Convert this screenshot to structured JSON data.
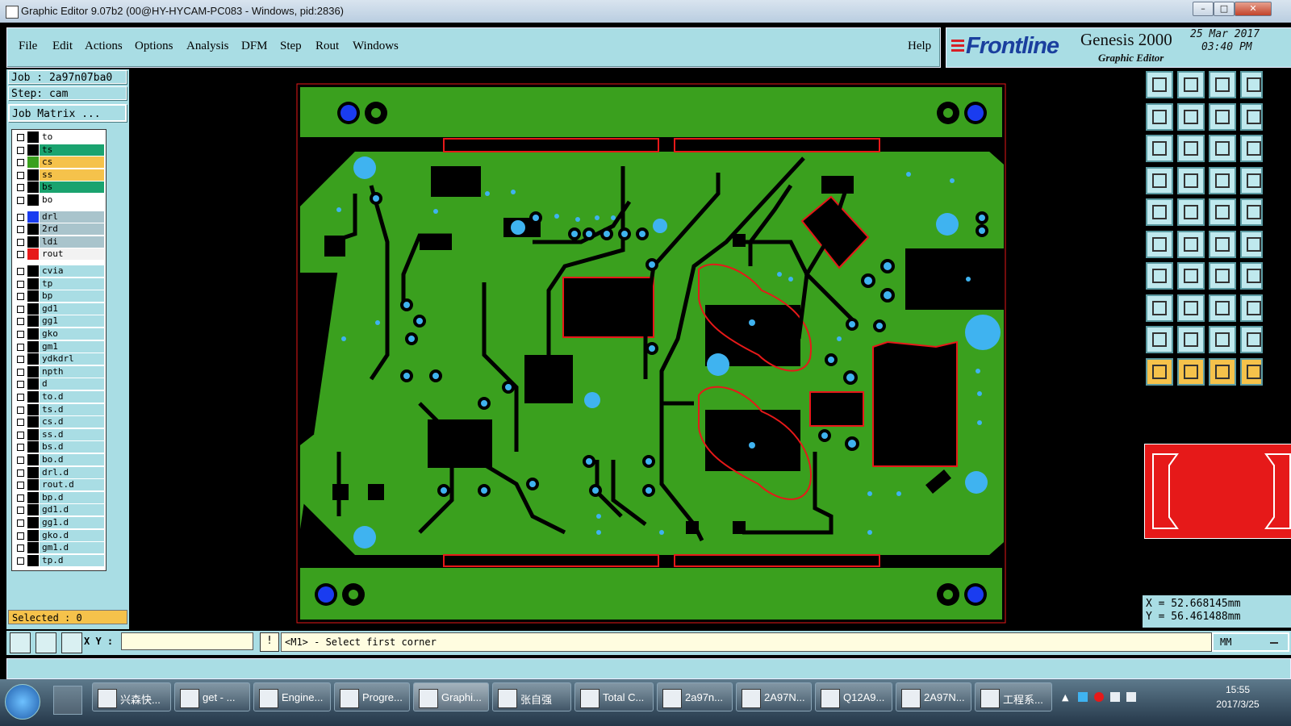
{
  "window": {
    "title": "Graphic Editor 9.07b2 (00@HY-HYCAM-PC083 - Windows, pid:2836)"
  },
  "menu": {
    "items": [
      "File",
      "Edit",
      "Actions",
      "Options",
      "Analysis",
      "DFM",
      "Step",
      "Rout",
      "Windows"
    ],
    "help": "Help"
  },
  "branding": {
    "logo": "Frontline",
    "product": "Genesis 2000",
    "subtitle": "Graphic Editor",
    "date": "25 Mar 2017",
    "time": "03:40 PM"
  },
  "job": {
    "job_label": "Job : 2a97n07ba0",
    "step_label": "Step: cam",
    "matrix_button": "Job Matrix ..."
  },
  "layers": [
    {
      "name": "to",
      "color": "#ffffff",
      "swatch": "#000000"
    },
    {
      "name": "ts",
      "color": "#1aa36f",
      "swatch": "#000000"
    },
    {
      "name": "cs",
      "color": "#f5c24b",
      "swatch": "#3aa01e"
    },
    {
      "name": "ss",
      "color": "#f5c24b",
      "swatch": "#000000"
    },
    {
      "name": "bs",
      "color": "#1aa36f",
      "swatch": "#000000"
    },
    {
      "name": "bo",
      "color": "#ffffff",
      "swatch": "#000000"
    },
    {
      "name": "drl",
      "color": "#a9c4cc",
      "swatch": "#1a3cf0"
    },
    {
      "name": "2rd",
      "color": "#a9c4cc",
      "swatch": "#000000"
    },
    {
      "name": "ldi",
      "color": "#a9c4cc",
      "swatch": "#000000"
    },
    {
      "name": "rout",
      "color": "#f2f2f2",
      "swatch": "#e61919"
    },
    {
      "name": "cvia",
      "color": "#a9dde4",
      "swatch": "#000000"
    },
    {
      "name": "tp",
      "color": "#a9dde4",
      "swatch": "#000000"
    },
    {
      "name": "bp",
      "color": "#a9dde4",
      "swatch": "#000000"
    },
    {
      "name": "gd1",
      "color": "#a9dde4",
      "swatch": "#000000"
    },
    {
      "name": "gg1",
      "color": "#a9dde4",
      "swatch": "#000000"
    },
    {
      "name": "gko",
      "color": "#a9dde4",
      "swatch": "#000000"
    },
    {
      "name": "gm1",
      "color": "#a9dde4",
      "swatch": "#000000"
    },
    {
      "name": "ydkdrl",
      "color": "#a9dde4",
      "swatch": "#000000"
    },
    {
      "name": "npth",
      "color": "#a9dde4",
      "swatch": "#000000"
    },
    {
      "name": "d",
      "color": "#a9dde4",
      "swatch": "#000000"
    },
    {
      "name": "to.d",
      "color": "#a9dde4",
      "swatch": "#000000"
    },
    {
      "name": "ts.d",
      "color": "#a9dde4",
      "swatch": "#000000"
    },
    {
      "name": "cs.d",
      "color": "#a9dde4",
      "swatch": "#000000"
    },
    {
      "name": "ss.d",
      "color": "#a9dde4",
      "swatch": "#000000"
    },
    {
      "name": "bs.d",
      "color": "#a9dde4",
      "swatch": "#000000"
    },
    {
      "name": "bo.d",
      "color": "#a9dde4",
      "swatch": "#000000"
    },
    {
      "name": "drl.d",
      "color": "#a9dde4",
      "swatch": "#000000"
    },
    {
      "name": "rout.d",
      "color": "#a9dde4",
      "swatch": "#000000"
    },
    {
      "name": "bp.d",
      "color": "#a9dde4",
      "swatch": "#000000"
    },
    {
      "name": "gd1.d",
      "color": "#a9dde4",
      "swatch": "#000000"
    },
    {
      "name": "gg1.d",
      "color": "#a9dde4",
      "swatch": "#000000"
    },
    {
      "name": "gko.d",
      "color": "#a9dde4",
      "swatch": "#000000"
    },
    {
      "name": "gm1.d",
      "color": "#a9dde4",
      "swatch": "#000000"
    },
    {
      "name": "tp.d",
      "color": "#a9dde4",
      "swatch": "#000000"
    }
  ],
  "selected": "Selected : 0",
  "coords": {
    "x": "X  =  52.668145mm",
    "y": "Y  =  56.461488mm"
  },
  "command": {
    "xy_label": "X Y :",
    "xy_value": "",
    "prompt": "<M1> - Select first corner",
    "units": "MM"
  },
  "colors": {
    "board": "#3aa01e",
    "pad": "#3fb3f0",
    "drill": "#1a3cf0",
    "rout": "#e61919",
    "panel": "#a9dde4"
  },
  "taskbar": {
    "tasks": [
      "兴森快...",
      "get - ...",
      "Engine...",
      "Progre...",
      "Graphi...",
      "张自强",
      "Total C...",
      "2a97n...",
      "2A97N...",
      "Q12A9...",
      "2A97N...",
      "工程系..."
    ],
    "clock_time": "15:55",
    "clock_date": "2017/3/25"
  }
}
